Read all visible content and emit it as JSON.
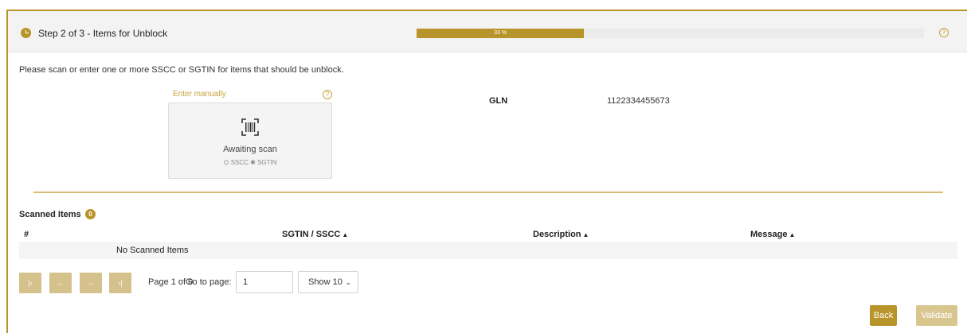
{
  "header": {
    "step_title": "Step 2 of 3 - Items for Unblock",
    "progress_label": "33 %",
    "progress_fraction": 0.33,
    "help": "?"
  },
  "instruction": "Please scan or enter one or more SSCC or SGTIN for items that should be unblock.",
  "scanner": {
    "enter_manually": "Enter manually",
    "help": "?",
    "status": "Awaiting scan",
    "types": "⌬ SSCC  ✱ SGTIN"
  },
  "gln": {
    "label": "GLN",
    "value": "1122334455673"
  },
  "scanned": {
    "title": "Scanned Items",
    "count": "0",
    "columns": [
      "#",
      "SGTIN / SSCC",
      "Description",
      "Message"
    ],
    "sort_icon": "▲",
    "empty_text": "No Scanned Items"
  },
  "pager": {
    "first": "|‹",
    "prev": "←",
    "next": "→",
    "last": "›|",
    "page_info": "Page 1 of 0",
    "go_to_label": "Go to page:",
    "page_value": "1",
    "show_value": "Show 10",
    "chevron": "⌄"
  },
  "actions": {
    "back": "Back",
    "validate": "Validate"
  },
  "colors": {
    "accent": "#b8952a",
    "accent_light": "#d5c18b"
  }
}
